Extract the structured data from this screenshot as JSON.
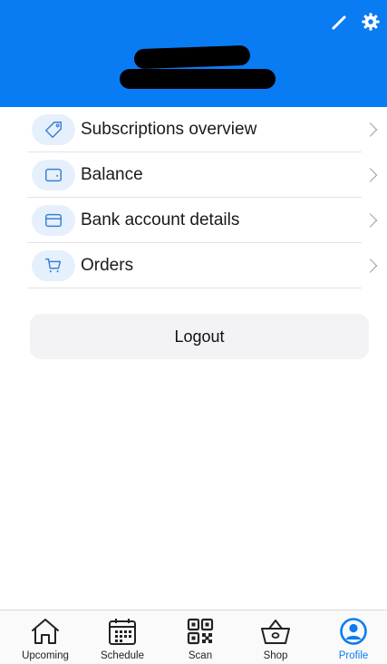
{
  "header": {
    "background": "#0a7cf3",
    "name_redacted": true,
    "actions": [
      {
        "name": "edit",
        "icon": "pencil-icon"
      },
      {
        "name": "settings",
        "icon": "gear-icon"
      }
    ]
  },
  "menu": {
    "items": [
      {
        "label": "Subscriptions overview",
        "icon": "tag-icon"
      },
      {
        "label": "Balance",
        "icon": "wallet-icon"
      },
      {
        "label": "Bank account details",
        "icon": "credit-card-icon"
      },
      {
        "label": "Orders",
        "icon": "cart-icon"
      }
    ]
  },
  "logout": {
    "label": "Logout"
  },
  "tabbar": {
    "active_color": "#0a7cf3",
    "tabs": [
      {
        "label": "Upcoming",
        "icon": "home-icon",
        "active": false
      },
      {
        "label": "Schedule",
        "icon": "calendar-icon",
        "active": false
      },
      {
        "label": "Scan",
        "icon": "qr-code-icon",
        "active": false
      },
      {
        "label": "Shop",
        "icon": "basket-icon",
        "active": false
      },
      {
        "label": "Profile",
        "icon": "user-circle-icon",
        "active": true
      }
    ]
  }
}
